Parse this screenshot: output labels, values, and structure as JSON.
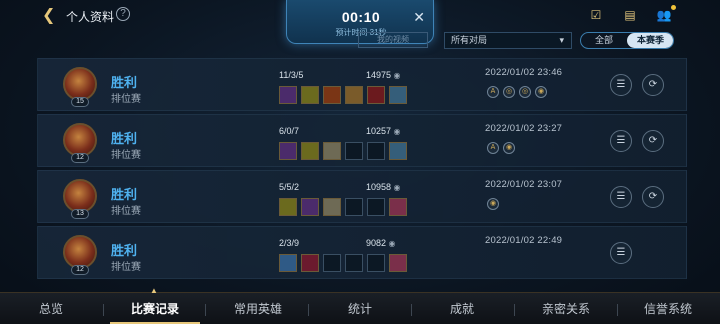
{
  "header": {
    "back_icon": "chevron-left-icon",
    "title": "个人资料",
    "help_label": "?",
    "icons": [
      "checklist-icon",
      "chat-icon",
      "friends-icon"
    ]
  },
  "timer": {
    "time": "00:10",
    "subtitle": "预计时间 31秒",
    "close_label": "✕",
    "hidden_button": "我的视频"
  },
  "filter": {
    "selected": "所有对局",
    "chevron": "⌄"
  },
  "segment": {
    "options": [
      "全部",
      "本赛季"
    ],
    "selected": "本赛季"
  },
  "matches": [
    {
      "level": "15",
      "result": "胜利",
      "mode": "排位赛",
      "kda": "11/3/5",
      "gold": "14975",
      "time": "2022/01/02 23:46",
      "items_filled": 6,
      "badges": [
        "A",
        "◎",
        "◎",
        "◉"
      ],
      "buttons": [
        "list",
        "replay"
      ]
    },
    {
      "level": "12",
      "result": "胜利",
      "mode": "排位赛",
      "kda": "6/0/7",
      "gold": "10257",
      "time": "2022/01/02 23:27",
      "items_filled": 3,
      "badges": [
        "A",
        "◉"
      ],
      "buttons": [
        "list",
        "replay"
      ]
    },
    {
      "level": "13",
      "result": "胜利",
      "mode": "排位赛",
      "kda": "5/5/2",
      "gold": "10958",
      "time": "2022/01/02 23:07",
      "items_filled": 3,
      "badges": [
        "◉"
      ],
      "buttons": [
        "list",
        "replay"
      ]
    },
    {
      "level": "12",
      "result": "胜利",
      "mode": "排位赛",
      "kda": "2/3/9",
      "gold": "9082",
      "time": "2022/01/02 22:49",
      "items_filled": 2,
      "badges": [],
      "buttons": [
        "list"
      ]
    }
  ],
  "nav": {
    "items": [
      "总览",
      "比赛记录",
      "常用英雄",
      "统计",
      "成就",
      "亲密关系",
      "信誉系统"
    ],
    "active": "比赛记录"
  },
  "colors": {
    "win": "#4fb2f0",
    "accent_gold": "#e6c77b",
    "background": "#0b1521"
  }
}
